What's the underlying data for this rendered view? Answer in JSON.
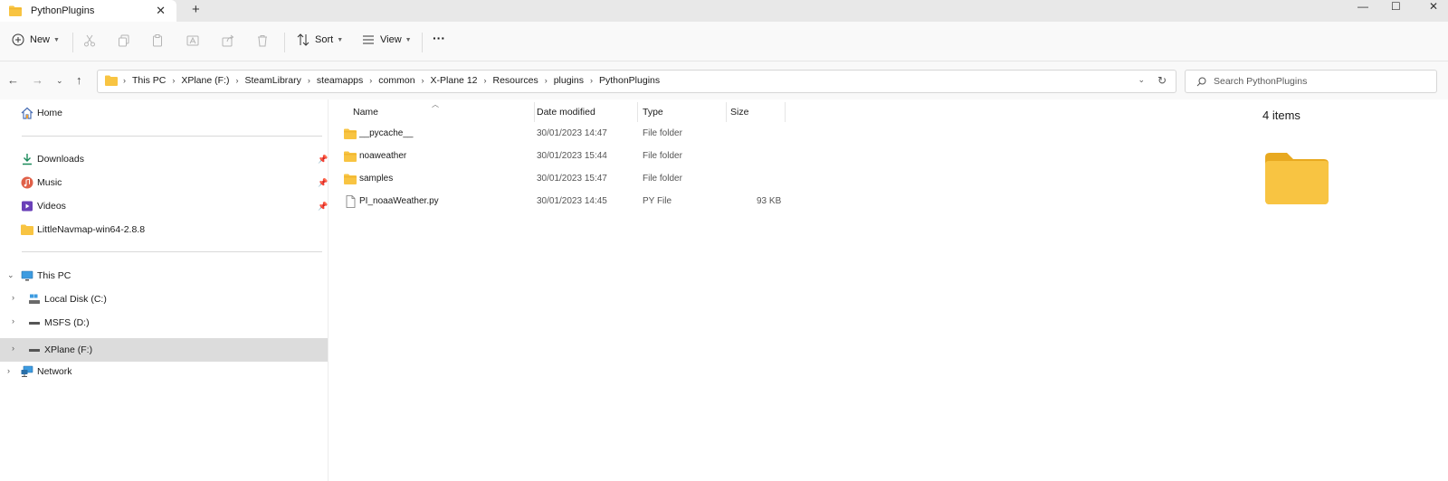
{
  "tab": {
    "title": "PythonPlugins",
    "close_glyph": "✕",
    "new_tab_glyph": "+"
  },
  "window_controls": {
    "minimize": "—",
    "maximize": "☐",
    "close": "✕"
  },
  "command_bar": {
    "new_label": "New",
    "sort_label": "Sort",
    "view_label": "View",
    "more_glyph": "···"
  },
  "address_bar": {
    "crumbs": [
      "This PC",
      "XPlane (F:)",
      "SteamLibrary",
      "steamapps",
      "common",
      "X-Plane 12",
      "Resources",
      "plugins",
      "PythonPlugins"
    ],
    "separator": "›"
  },
  "search": {
    "placeholder": "Search PythonPlugins"
  },
  "sidebar": {
    "home": "Home",
    "quick_access": [
      {
        "label": "Downloads",
        "icon": "download-icon",
        "pinned": true
      },
      {
        "label": "Music",
        "icon": "music-icon",
        "pinned": true
      },
      {
        "label": "Videos",
        "icon": "video-icon",
        "pinned": true
      },
      {
        "label": "LittleNavmap-win64-2.8.8",
        "icon": "folder-icon",
        "pinned": false
      }
    ],
    "this_pc": "This PC",
    "drives": [
      {
        "label": "Local Disk (C:)",
        "icon": "drive-icon"
      },
      {
        "label": "MSFS (D:)",
        "icon": "drive-icon"
      },
      {
        "label": "XPlane (F:)",
        "icon": "drive-icon",
        "selected": true
      }
    ],
    "network": "Network",
    "pin_glyph": "📌"
  },
  "columns": {
    "name": "Name",
    "date": "Date modified",
    "type": "Type",
    "size": "Size"
  },
  "files": [
    {
      "name": "__pycache__",
      "date": "30/01/2023 14:47",
      "type": "File folder",
      "size": "",
      "kind": "folder"
    },
    {
      "name": "noaweather",
      "date": "30/01/2023 15:44",
      "type": "File folder",
      "size": "",
      "kind": "folder"
    },
    {
      "name": "samples",
      "date": "30/01/2023 15:47",
      "type": "File folder",
      "size": "",
      "kind": "folder"
    },
    {
      "name": "PI_noaaWeather.py",
      "date": "30/01/2023 14:45",
      "type": "PY File",
      "size": "93 KB",
      "kind": "file"
    }
  ],
  "details": {
    "count": "4 items"
  },
  "colors": {
    "folder": "#f8c442",
    "folder_dark": "#e8a920",
    "accent": "#0067c0",
    "selected": "#dcdcdc"
  }
}
